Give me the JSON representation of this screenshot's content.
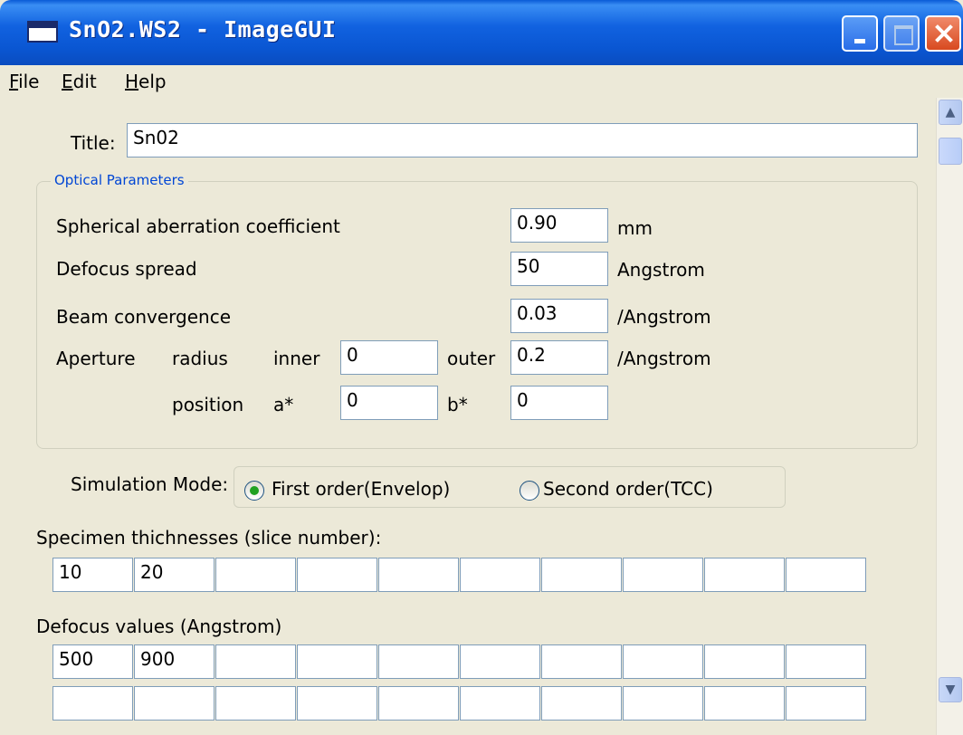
{
  "window": {
    "title": "SnO2.WS2 - ImageGUI"
  },
  "menu": [
    "File",
    "Edit",
    "Help"
  ],
  "title_field": {
    "label": "Title:",
    "value": "Sn02"
  },
  "optical": {
    "legend": "Optical Parameters",
    "spherical": {
      "label": "Spherical aberration coefficient",
      "value": "0.90",
      "unit": "mm"
    },
    "defocus_spread": {
      "label": "Defocus spread",
      "value": "50",
      "unit": "Angstrom"
    },
    "beam": {
      "label": "Beam convergence",
      "value": "0.03",
      "unit": "/Angstrom"
    },
    "aperture": {
      "label": "Aperture",
      "radius_label": "radius",
      "inner_label": "inner",
      "inner_value": "0",
      "outer_label": "outer",
      "outer_value": "0.2",
      "unit": "/Angstrom",
      "position_label": "position",
      "a_label": "a*",
      "a_value": "0",
      "b_label": "b*",
      "b_value": "0"
    }
  },
  "simulation": {
    "label": "Simulation Mode:",
    "options": [
      "First order(Envelop)",
      "Second order(TCC)"
    ],
    "selected": "First order(Envelop)"
  },
  "thickness": {
    "label": "Specimen thichnesses (slice number):",
    "values": [
      "10",
      "20",
      "",
      "",
      "",
      "",
      "",
      "",
      "",
      ""
    ]
  },
  "defocus": {
    "label": "Defocus values (Angstrom)",
    "row1": [
      "500",
      "900",
      "",
      "",
      "",
      "",
      "",
      "",
      "",
      ""
    ],
    "row2": [
      "",
      "",
      "",
      "",
      "",
      "",
      "",
      "",
      "",
      ""
    ]
  }
}
